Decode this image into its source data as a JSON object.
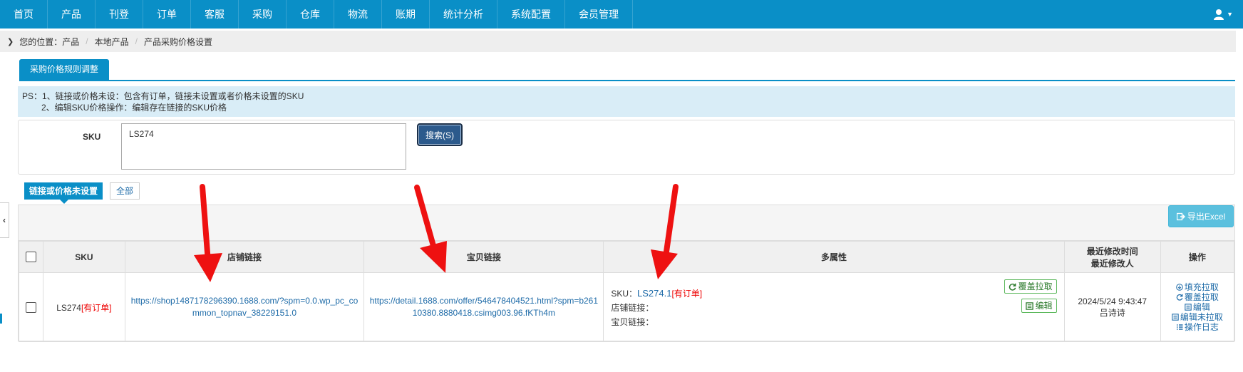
{
  "topnav": {
    "items": [
      "首页",
      "产品",
      "刊登",
      "订单",
      "客服",
      "采购",
      "仓库",
      "物流",
      "账期",
      "统计分析",
      "系统配置",
      "会员管理"
    ],
    "user_icon": "user-icon"
  },
  "breadcrumb": {
    "prefix": "您的位置：",
    "items": [
      "产品",
      "本地产品",
      "产品采购价格设置"
    ]
  },
  "tab": {
    "label": "采购价格规则调整"
  },
  "notice": {
    "line1": "PS：1、链接或价格未设：包含有订单，链接未设置或者价格未设置的SKU",
    "line2": "2、编辑SKU价格操作：编辑存在链接的SKU价格"
  },
  "search": {
    "label": "SKU",
    "value": "LS274",
    "button": "搜索(S)"
  },
  "filters": {
    "active": "链接或价格未设置",
    "all": "全部"
  },
  "export_button": "导出Excel",
  "table": {
    "headers": [
      "SKU",
      "店铺链接",
      "宝贝链接",
      "多属性",
      "最近修改时间",
      "最近修改人",
      "操作"
    ],
    "rows": [
      {
        "sku": "LS274",
        "sku_tag": "[有订单]",
        "shop_link": "https://shop1487178296390.1688.com/?spm=0.0.wp_pc_common_topnav_38229151.0",
        "item_link": "https://detail.1688.com/offer/546478404521.html?spm=b26110380.8880418.csimg003.96.fKTh4m",
        "attr_sku_label": "SKU：",
        "attr_sku": "LS274.1",
        "attr_sku_tag": "[有订单]",
        "attr_shop_label": "店铺链接：",
        "attr_item_label": "宝贝链接：",
        "btn_cover": "覆盖拉取",
        "btn_edit": "编辑",
        "modified_time": "2024/5/24 9:43:47",
        "modified_by": "吕诗诗",
        "ops": [
          "填充拉取",
          "覆盖拉取",
          "编辑",
          "编辑未拉取",
          "操作日志"
        ]
      }
    ]
  },
  "colors": {
    "nav": "#0a8fc7",
    "notice_bg": "#d9edf7",
    "search_btn": "#2c5a8c",
    "export_btn": "#5bc0de",
    "annotation_arrow": "#ee1111"
  }
}
